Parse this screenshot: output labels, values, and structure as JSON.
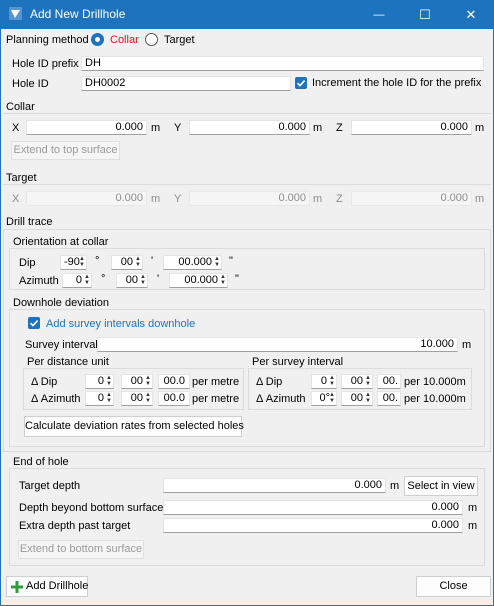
{
  "window": {
    "title": "Add New Drillhole",
    "minimize_glyph": "—",
    "maximize_glyph": "☐",
    "close_glyph": "✕"
  },
  "planning": {
    "label": "Planning method",
    "options": [
      "Collar",
      "Target"
    ],
    "selected": "Collar"
  },
  "hole_id_prefix": {
    "label": "Hole ID prefix",
    "value": "DH"
  },
  "hole_id": {
    "label": "Hole ID",
    "value": "DH0002",
    "increment_label": "Increment the hole ID for the prefix",
    "increment_checked": true
  },
  "collar": {
    "heading": "Collar",
    "x_label": "X",
    "x_value": "0.000",
    "x_unit": "m",
    "y_label": "Y",
    "y_value": "0.000",
    "y_unit": "m",
    "z_label": "Z",
    "z_value": "0.000",
    "z_unit": "m",
    "extend_button": "Extend to top surface"
  },
  "target": {
    "heading": "Target",
    "x_label": "X",
    "x_value": "0.000",
    "x_unit": "m",
    "y_label": "Y",
    "y_value": "0.000",
    "y_unit": "m",
    "z_label": "Z",
    "z_value": "0.000",
    "z_unit": "m"
  },
  "drill_trace": {
    "heading": "Drill trace",
    "orientation": {
      "heading": "Orientation at collar",
      "dip_label": "Dip",
      "dip_deg": "-90",
      "dip_min": "00",
      "dip_sec": "00.000",
      "azimuth_label": "Azimuth",
      "az_deg": "0",
      "az_min": "00",
      "az_sec": "00.000",
      "deg_sym": "°",
      "min_sym": "'",
      "sec_sym": "\""
    },
    "downhole": {
      "heading": "Downhole deviation",
      "add_survey_label": "Add survey intervals downhole",
      "add_survey_checked": true,
      "survey_interval_label": "Survey interval",
      "survey_interval_value": "10.000",
      "survey_interval_unit": "m",
      "per_distance": {
        "heading": "Per distance unit",
        "dip_label": "Δ Dip",
        "dip_deg": "0",
        "dip_min": "00",
        "dip_sec": "00.0",
        "azimuth_label": "Δ Azimuth",
        "az_deg": "0",
        "az_min": "00",
        "az_sec": "00.0",
        "unit": "per metre"
      },
      "per_survey": {
        "heading": "Per survey interval",
        "dip_label": "Δ Dip",
        "dip_deg": "0",
        "dip_min": "00",
        "dip_sec": "00.",
        "azimuth_label": "Δ Azimuth",
        "az_deg": "0°",
        "az_min": "00",
        "az_sec": "00.",
        "unit": "per 10.000m"
      },
      "calc_button": "Calculate deviation rates from selected holes"
    }
  },
  "end_of_hole": {
    "heading": "End of hole",
    "target_depth_label": "Target depth",
    "target_depth_value": "0.000",
    "target_depth_unit": "m",
    "select_in_view": "Select in view",
    "beyond_label": "Depth beyond bottom surface",
    "beyond_value": "0.000",
    "beyond_unit": "m",
    "extra_label": "Extra depth past target",
    "extra_value": "0.000",
    "extra_unit": "m",
    "extend_bottom_button": "Extend to bottom surface"
  },
  "footer": {
    "add_button": "Add Drillhole",
    "close_button": "Close"
  },
  "colors": {
    "accent": "#1e73be",
    "collar_label": "#e81123",
    "add_icon": "#2e9d3e"
  }
}
